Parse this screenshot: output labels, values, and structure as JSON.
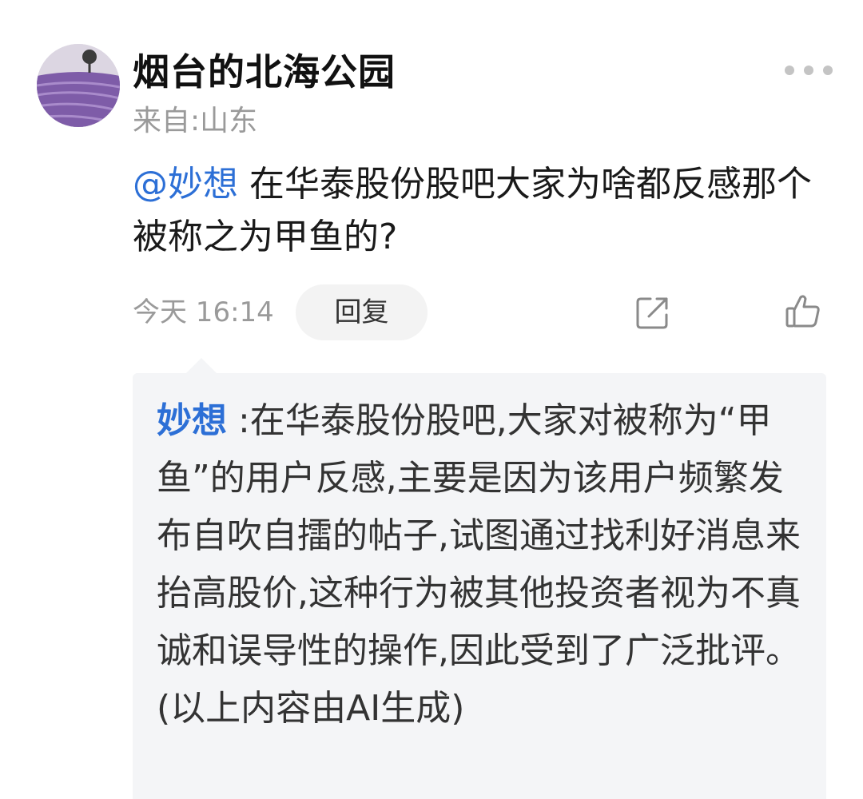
{
  "header": {
    "username": "烟台的北海公园",
    "location": "来自:山东",
    "avatar_icon": "lavender-field-avatar",
    "more_icon": "more-dots-icon"
  },
  "comment": {
    "mention": "@妙想",
    "text": " 在华泰股份股吧大家为啥都反感那个被称之为甲鱼的?"
  },
  "actions": {
    "time": "今天 16:14",
    "reply_label": "回复",
    "share_icon": "share-icon",
    "like_icon": "thumbs-up-icon"
  },
  "reply": {
    "author": "妙想",
    "text": " :在华泰股份股吧,大家对被称为“甲鱼”的用户反感,主要是因为该用户频繁发布自吹自擂的帖子,试图通过找利好消息来抬高股价,这种行为被其他投资者视为不真诚和误导性的操作,因此受到了广泛批评。",
    "note": "(以上内容由AI生成)"
  },
  "colors": {
    "mention": "#2c6fd6",
    "secondary_text": "#9a9a9a",
    "card_bg": "#f4f5f7"
  }
}
